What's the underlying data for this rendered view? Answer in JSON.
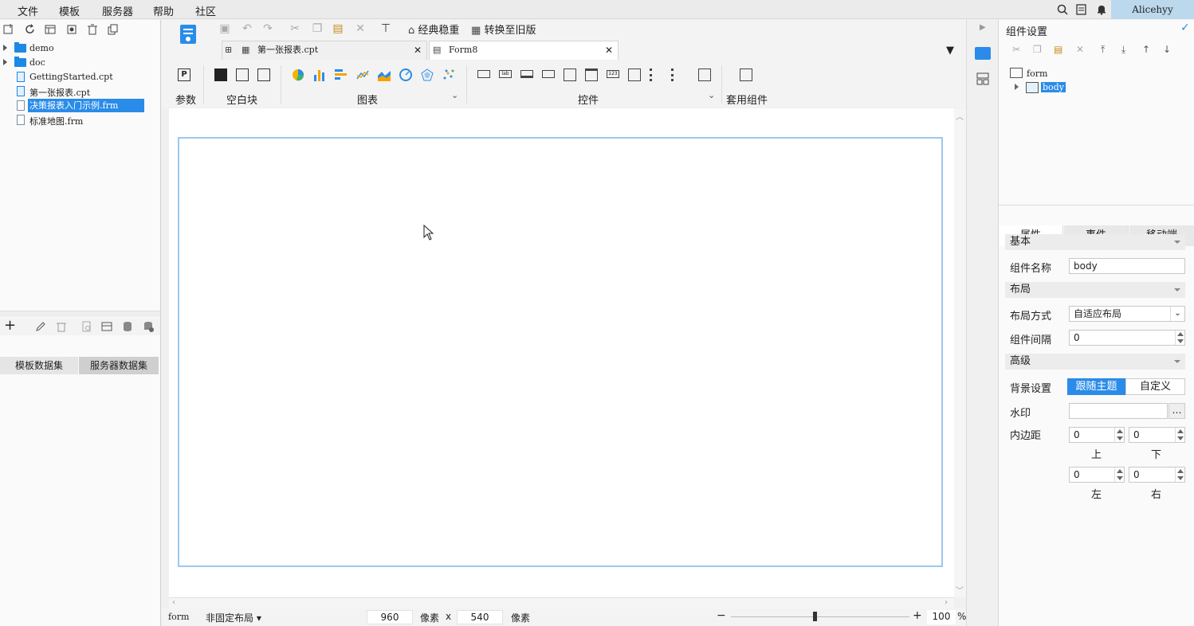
{
  "menubar": {
    "items": [
      "文件",
      "模板",
      "服务器",
      "帮助",
      "社区"
    ],
    "user": "Alicehyy"
  },
  "file_tree": {
    "items": [
      {
        "label": "demo",
        "type": "folder"
      },
      {
        "label": "doc",
        "type": "folder"
      },
      {
        "label": "GettingStarted.cpt",
        "type": "cpt"
      },
      {
        "label": "第一张报表.cpt",
        "type": "cpt"
      },
      {
        "label": "决策报表入门示例.frm",
        "type": "frm",
        "selected": true
      },
      {
        "label": "标准地图.frm",
        "type": "frm"
      }
    ]
  },
  "dataset_tabs": [
    "模板数据集",
    "服务器数据集"
  ],
  "toolbar": {
    "classic": "经典稳重",
    "convert": "转换至旧版"
  },
  "doc_tabs": [
    {
      "label": "第一张报表.cpt"
    },
    {
      "label": "Form8",
      "active": true
    }
  ],
  "ribbon": {
    "param": "参数",
    "blank": "空白块",
    "chart": "图表",
    "widget": "控件",
    "pkg": "套用组件"
  },
  "statusbar": {
    "name": "form",
    "layout": "非固定布局",
    "width": "960",
    "unit1": "像素",
    "x": "x",
    "height": "540",
    "unit2": "像素",
    "zoom": "100",
    "percent": "%"
  },
  "right_panel": {
    "title": "组件设置",
    "tree_root": "form",
    "tree_child": "body",
    "tabs": [
      "属性",
      "事件",
      "移动端"
    ],
    "sections": {
      "basic": "基本",
      "layout": "布局",
      "advanced": "高级"
    },
    "props": {
      "name_label": "组件名称",
      "name_value": "body",
      "layout_label": "布局方式",
      "layout_value": "自适应布局",
      "gap_label": "组件间隔",
      "gap_value": "0",
      "bg_label": "背景设置",
      "bg_theme": "跟随主题",
      "bg_custom": "自定义",
      "watermark_label": "水印",
      "padding_label": "内边距",
      "pad_top": "0",
      "pad_bottom": "0",
      "pad_left": "0",
      "pad_right": "0",
      "top": "上",
      "bottom": "下",
      "left": "左",
      "right": "右"
    }
  },
  "colors": {
    "accent": "#2a8ce8",
    "canvas_border": "#9cc8ee"
  }
}
